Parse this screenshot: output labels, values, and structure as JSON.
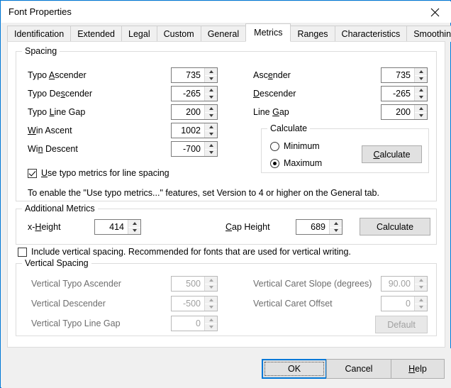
{
  "window": {
    "title": "Font Properties",
    "close_icon": "close-icon",
    "accent_color": "#0078d7"
  },
  "tabs": [
    {
      "label": "Identification",
      "active": false
    },
    {
      "label": "Extended",
      "active": false
    },
    {
      "label": "Legal",
      "active": false
    },
    {
      "label": "Custom",
      "active": false
    },
    {
      "label": "General",
      "active": false
    },
    {
      "label": "Metrics",
      "active": true
    },
    {
      "label": "Ranges",
      "active": false
    },
    {
      "label": "Characteristics",
      "active": false
    },
    {
      "label": "Smoothing",
      "active": false
    }
  ],
  "spacing": {
    "group_label": "Spacing",
    "left_fields": [
      {
        "label_pre": "Typo ",
        "label_acc": "A",
        "label_post": "scender",
        "value": "735"
      },
      {
        "label_pre": "Typo De",
        "label_acc": "s",
        "label_post": "cender",
        "value": "-265"
      },
      {
        "label_pre": "Typo ",
        "label_acc": "L",
        "label_post": "ine Gap",
        "value": "200"
      },
      {
        "label_pre": "",
        "label_acc": "W",
        "label_post": "in Ascent",
        "value": "1002"
      },
      {
        "label_pre": "Wi",
        "label_acc": "n",
        "label_post": " Descent",
        "value": "-700"
      }
    ],
    "right_fields": [
      {
        "label_pre": "Asc",
        "label_acc": "e",
        "label_post": "nder",
        "value": "735"
      },
      {
        "label_pre": "",
        "label_acc": "D",
        "label_post": "escender",
        "value": "-265"
      },
      {
        "label_pre": "Line ",
        "label_acc": "G",
        "label_post": "ap",
        "value": "200"
      }
    ],
    "calculate_group": {
      "label": "Calculate",
      "options": [
        {
          "label": "Minimum",
          "selected": false
        },
        {
          "label": "Maximum",
          "selected": true
        }
      ],
      "button_pre": "",
      "button_acc": "C",
      "button_post": "alculate"
    },
    "typo_checkbox": {
      "checked": true,
      "label_pre": "",
      "label_acc": "U",
      "label_post": "se typo metrics for line spacing"
    },
    "hint": "To enable the \"Use typo metrics...\" features, set Version to 4 or higher on the General tab."
  },
  "additional_metrics": {
    "group_label": "Additional Metrics",
    "x_height": {
      "label_pre": "x-",
      "label_acc": "H",
      "label_post": "eight",
      "value": "414"
    },
    "cap_height": {
      "label_pre": "",
      "label_acc": "C",
      "label_post": "ap Height",
      "value": "689"
    },
    "calculate_button": "Calculate"
  },
  "vertical": {
    "include_checkbox": {
      "checked": false,
      "label": "Include vertical spacing. Recommended for fonts that are used for vertical writing."
    },
    "group_label": "Vertical Spacing",
    "left_fields": [
      {
        "label": "Vertical Typo Ascender",
        "value": "500",
        "disabled": true
      },
      {
        "label": "Vertical Descender",
        "value": "-500",
        "disabled": true
      },
      {
        "label": "Vertical Typo Line Gap",
        "value": "0",
        "disabled": true
      }
    ],
    "right_fields": [
      {
        "label": "Vertical Caret Slope (degrees)",
        "value": "90.00",
        "disabled": true
      },
      {
        "label": "Vertical Caret Offset",
        "value": "0",
        "disabled": true
      }
    ],
    "default_button": {
      "label": "Default",
      "disabled": true
    }
  },
  "dialog_buttons": {
    "ok": "OK",
    "cancel": "Cancel",
    "help_pre": "",
    "help_acc": "H",
    "help_post": "elp"
  }
}
